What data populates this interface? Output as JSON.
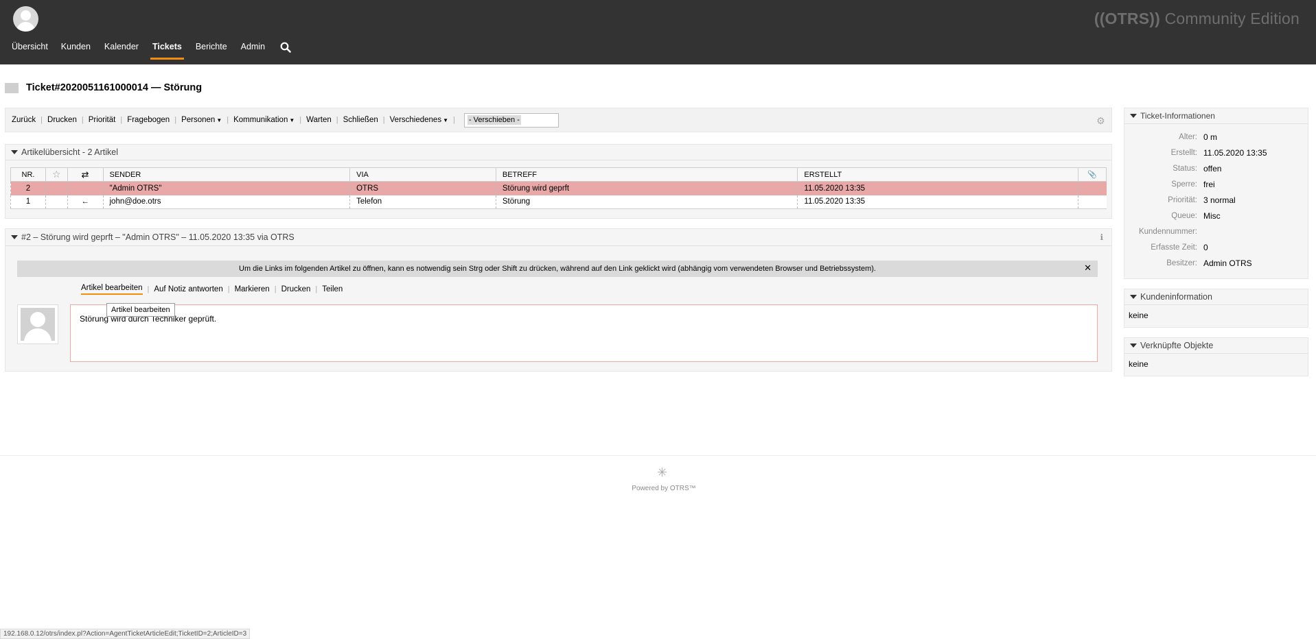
{
  "header": {
    "brand_prefix": "((OTRS))",
    "brand_suffix": " Community Edition",
    "nav": [
      "Übersicht",
      "Kunden",
      "Kalender",
      "Tickets",
      "Berichte",
      "Admin"
    ]
  },
  "ticket": {
    "title": "Ticket#2020051161000014 — Störung"
  },
  "actions": {
    "items": [
      "Zurück",
      "Drucken",
      "Priorität",
      "Fragebogen",
      "Personen",
      "Kommunikation",
      "Warten",
      "Schließen",
      "Verschiedenes"
    ],
    "move_placeholder": "- Verschieben -"
  },
  "articles": {
    "header": "Artikelübersicht - 2 Artikel",
    "columns": [
      "NR.",
      "",
      "",
      "SENDER",
      "VIA",
      "BETREFF",
      "ERSTELLT",
      ""
    ],
    "rows": [
      {
        "nr": "2",
        "dir": "",
        "sender": "\"Admin OTRS\"",
        "via": "OTRS",
        "subject": "Störung wird geprft",
        "created": "11.05.2020 13:35"
      },
      {
        "nr": "1",
        "dir": "←",
        "sender": "john@doe.otrs",
        "via": "Telefon",
        "subject": "Störung",
        "created": "11.05.2020 13:35"
      }
    ]
  },
  "article_detail": {
    "header": "#2 – Störung wird geprft – \"Admin OTRS\" – 11.05.2020 13:35 via OTRS",
    "notice": "Um die Links im folgenden Artikel zu öffnen, kann es notwendig sein Strg oder Shift zu drücken, während auf den Link geklickt wird (abhängig vom verwendeten Browser und Betriebssystem).",
    "actions": [
      "Artikel bearbeiten",
      "Auf Notiz antworten",
      "Markieren",
      "Drucken",
      "Teilen"
    ],
    "body": "Störung wird durch Techniker geprüft.",
    "tooltip": "Artikel bearbeiten"
  },
  "sidebar": {
    "ticket_info": {
      "title": "Ticket-Informationen",
      "fields": [
        {
          "k": "Alter:",
          "v": "0 m"
        },
        {
          "k": "Erstellt:",
          "v": "11.05.2020 13:35"
        },
        {
          "k": "Status:",
          "v": "offen"
        },
        {
          "k": "Sperre:",
          "v": "frei"
        },
        {
          "k": "Priorität:",
          "v": "3 normal"
        },
        {
          "k": "Queue:",
          "v": "Misc"
        },
        {
          "k": "Kundennummer:",
          "v": ""
        },
        {
          "k": "Erfasste Zeit:",
          "v": "0"
        },
        {
          "k": "Besitzer:",
          "v": "Admin OTRS"
        }
      ]
    },
    "customer": {
      "title": "Kundeninformation",
      "value": "keine"
    },
    "linked": {
      "title": "Verknüpfte Objekte",
      "value": "keine"
    }
  },
  "footer": {
    "powered": "Powered by OTRS™"
  },
  "statusbar": {
    "url": "192.168.0.12/otrs/index.pl?Action=AgentTicketArticleEdit;TicketID=2;ArticleID=3"
  },
  "colors": {
    "header_bg": "#333333",
    "accent": "#f18e0e",
    "selected_row": "#e8a8a8"
  }
}
